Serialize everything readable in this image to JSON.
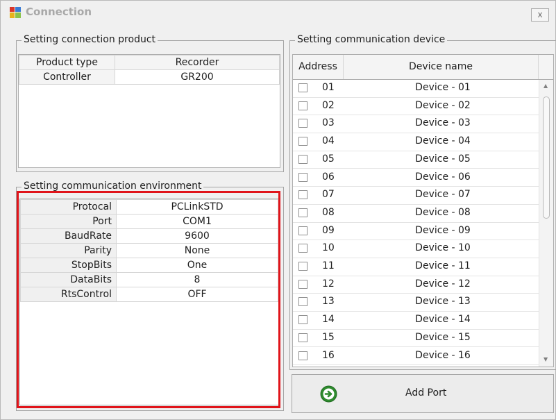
{
  "window": {
    "title": "Connection",
    "close_glyph": "x"
  },
  "product": {
    "group_label": "Setting connection product",
    "headers": [
      "Product type",
      "Recorder"
    ],
    "rows": [
      {
        "key": "Controller",
        "value": "GR200"
      }
    ]
  },
  "environment": {
    "group_label": "Setting communication environment",
    "rows": [
      {
        "key": "Protocal",
        "value": "PCLinkSTD"
      },
      {
        "key": "Port",
        "value": "COM1"
      },
      {
        "key": "BaudRate",
        "value": "9600"
      },
      {
        "key": "Parity",
        "value": "None"
      },
      {
        "key": "StopBits",
        "value": "One"
      },
      {
        "key": "DataBits",
        "value": "8"
      },
      {
        "key": "RtsControl",
        "value": "OFF"
      }
    ]
  },
  "devices": {
    "group_label": "Setting communication device",
    "columns": [
      "Address",
      "Device name"
    ],
    "rows": [
      {
        "address": "01",
        "name": "Device - 01"
      },
      {
        "address": "02",
        "name": "Device - 02"
      },
      {
        "address": "03",
        "name": "Device - 03"
      },
      {
        "address": "04",
        "name": "Device - 04"
      },
      {
        "address": "05",
        "name": "Device - 05"
      },
      {
        "address": "06",
        "name": "Device - 06"
      },
      {
        "address": "07",
        "name": "Device - 07"
      },
      {
        "address": "08",
        "name": "Device - 08"
      },
      {
        "address": "09",
        "name": "Device - 09"
      },
      {
        "address": "10",
        "name": "Device - 10"
      },
      {
        "address": "11",
        "name": "Device - 11"
      },
      {
        "address": "12",
        "name": "Device - 12"
      },
      {
        "address": "13",
        "name": "Device - 13"
      },
      {
        "address": "14",
        "name": "Device - 14"
      },
      {
        "address": "15",
        "name": "Device - 15"
      },
      {
        "address": "16",
        "name": "Device - 16"
      }
    ]
  },
  "actions": {
    "add_port_label": "Add Port",
    "add_port_icon": "arrow-right-circle-icon"
  },
  "colors": {
    "highlight_border": "#e0141a",
    "add_icon_green": "#2e8b2e"
  }
}
